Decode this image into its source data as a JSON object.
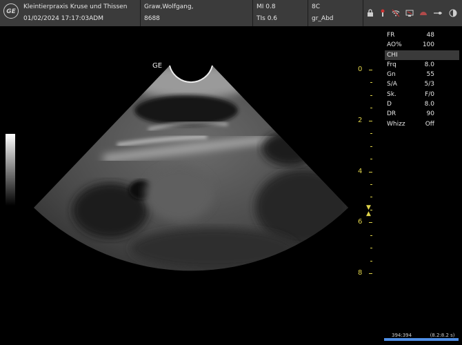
{
  "header": {
    "clinic": "Kleintierpraxis Kruse und Thissen",
    "datetime": "01/02/2024 17:17:03ADM",
    "patient_name": "Graw,Wolfgang,",
    "patient_id": "8688",
    "mi": "MI 0.8",
    "tis": "TIs 0.6",
    "probe": "8C",
    "preset": "gr_Abd",
    "logo_text": "GE",
    "icons": [
      "lock-icon",
      "probe-icon",
      "wifi-icon",
      "network-icon",
      "storage-icon",
      "usb-icon",
      "contrast-icon"
    ]
  },
  "image": {
    "probe_marker": "GE"
  },
  "params": [
    {
      "key": "FR",
      "value": "48"
    },
    {
      "key": "AO%",
      "value": "100"
    },
    {
      "key": "CHI",
      "value": ""
    },
    {
      "key": "Frq",
      "value": "8.0"
    },
    {
      "key": "Gn",
      "value": "55"
    },
    {
      "key": "S/A",
      "value": "5/3"
    },
    {
      "key": "Sk.",
      "value": "F/0"
    },
    {
      "key": "D",
      "value": "8.0"
    },
    {
      "key": "DR",
      "value": "90"
    },
    {
      "key": "Whizz",
      "value": "Off"
    }
  ],
  "depth_scale": {
    "labels": [
      "0",
      "2",
      "4",
      "6",
      "8"
    ],
    "unit_max": 8,
    "focus_depth": 5.3
  },
  "footer": {
    "frames": "394:394",
    "time_range": "(8.2:8.2 s)",
    "cine_progress": 1.0
  },
  "colors": {
    "header_bg": "#3b3b3b",
    "scale_yellow": "#e0d44a",
    "cine_blue": "#2f6fd0"
  }
}
